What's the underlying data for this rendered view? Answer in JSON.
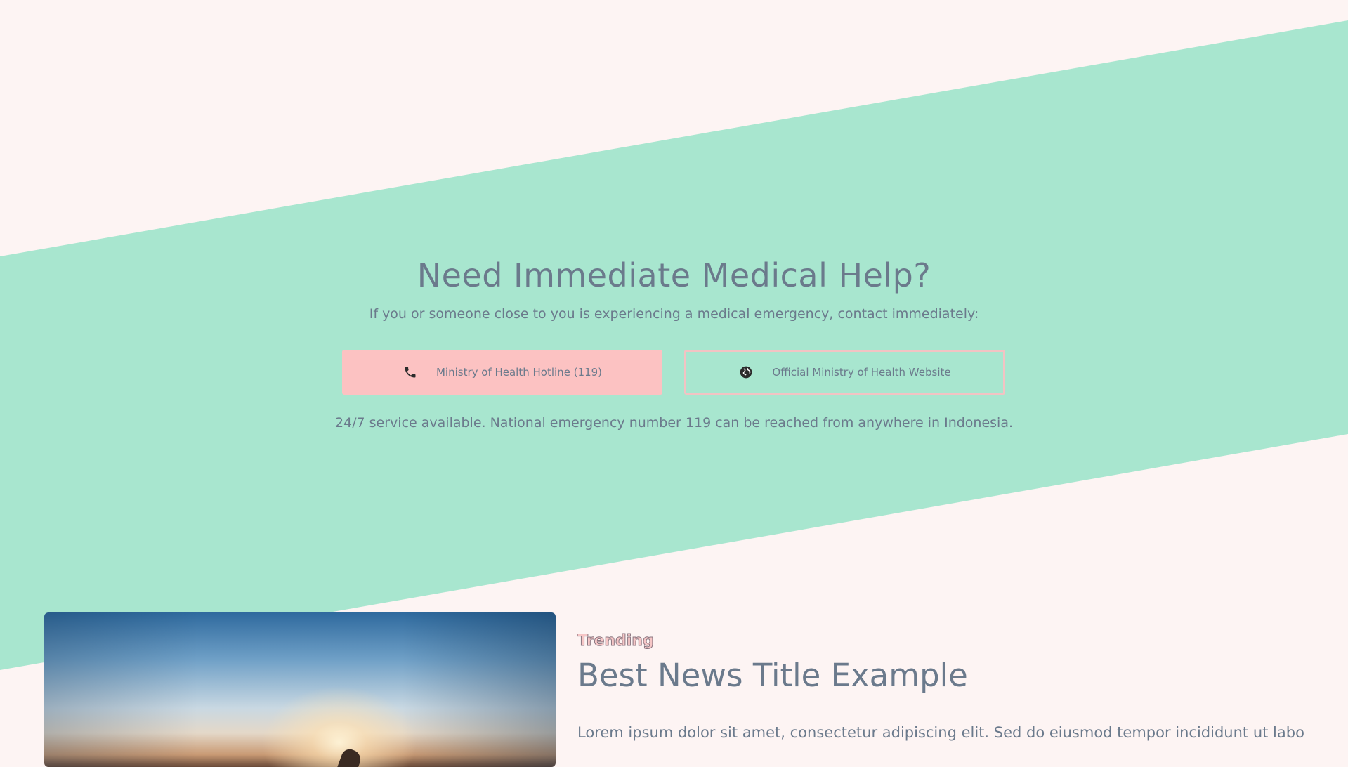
{
  "colors": {
    "page_background": "#fdf4f3",
    "band": "#a8e6cf",
    "text": "#6b7a8c",
    "hotline_button": "#fcc2c2",
    "website_button_border": "#f2c3c3",
    "trending_tag": "#f6c6c6"
  },
  "emergency": {
    "title": "Need Immediate Medical Help?",
    "subtitle": "If you or someone close to you is experiencing a medical emergency, contact immediately:",
    "hotline_button": {
      "icon": "phone-icon",
      "label": "Ministry of Health Hotline (119)"
    },
    "website_button": {
      "icon": "globe-icon",
      "label": "Official Ministry of Health Website"
    },
    "note": "24/7 service available. National emergency number 119 can be reached from anywhere in Indonesia."
  },
  "news": {
    "tag": "Trending",
    "title": "Best News Title Example",
    "excerpt": "Lorem ipsum dolor sit amet, consectetur adipiscing elit. Sed do eiusmod tempor incididunt ut labore et"
  }
}
